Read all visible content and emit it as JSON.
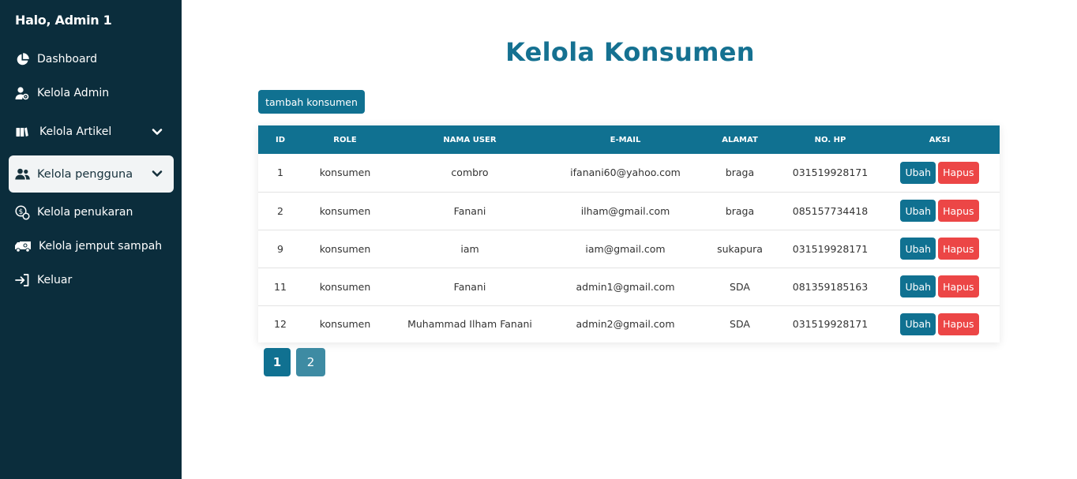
{
  "sidebar": {
    "greeting": "Halo, Admin 1",
    "items": [
      {
        "label": "Dashboard",
        "icon": "pie-chart-icon"
      },
      {
        "label": "Kelola Admin",
        "icon": "admin-user-icon"
      },
      {
        "label": "Kelola Artikel",
        "icon": "book-icon",
        "has_dropdown": true
      },
      {
        "label": "Kelola pengguna",
        "icon": "users-icon",
        "has_dropdown": true,
        "active": true
      },
      {
        "label": "Kelola penukaran",
        "icon": "coin-exchange-icon"
      },
      {
        "label": "Kelola jemput sampah",
        "icon": "truck-icon"
      },
      {
        "label": "Keluar",
        "icon": "logout-icon"
      }
    ]
  },
  "main": {
    "title": "Kelola Konsumen",
    "add_button": "tambah konsumen",
    "table": {
      "headers": [
        "ID",
        "ROLE",
        "NAMA USER",
        "E-MAIL",
        "ALAMAT",
        "NO. HP",
        "AKSI"
      ],
      "rows": [
        {
          "id": "1",
          "role": "konsumen",
          "name": "combro",
          "email": "ifanani60@yahoo.com",
          "address": "braga",
          "phone": "031519928171"
        },
        {
          "id": "2",
          "role": "konsumen",
          "name": "Fanani",
          "email": "ilham@gmail.com",
          "address": "braga",
          "phone": "085157734418"
        },
        {
          "id": "9",
          "role": "konsumen",
          "name": "iam",
          "email": "iam@gmail.com",
          "address": "sukapura",
          "phone": "031519928171"
        },
        {
          "id": "11",
          "role": "konsumen",
          "name": "Fanani",
          "email": "admin1@gmail.com",
          "address": "SDA",
          "phone": "081359185163"
        },
        {
          "id": "12",
          "role": "konsumen",
          "name": "Muhammad Ilham Fanani",
          "email": "admin2@gmail.com",
          "address": "SDA",
          "phone": "031519928171"
        }
      ],
      "edit_label": "Ubah",
      "delete_label": "Hapus"
    },
    "pagination": [
      "1",
      "2"
    ],
    "current_page": "1"
  },
  "colors": {
    "sidebar_bg": "#0b2d3c",
    "primary": "#107191",
    "danger": "#ec4646",
    "title": "#157191"
  }
}
